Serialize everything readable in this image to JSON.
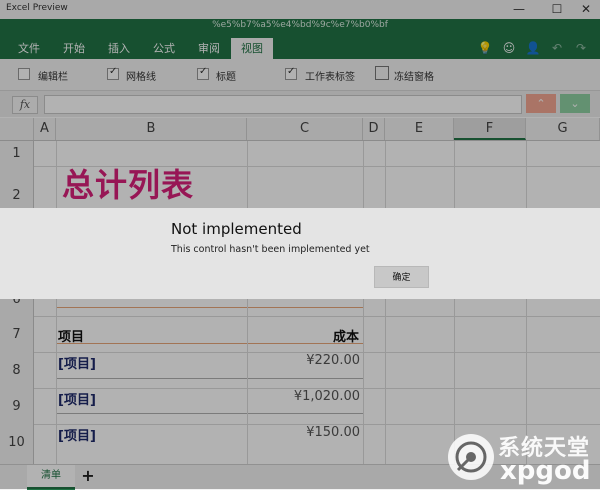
{
  "window": {
    "app_title": "Excel Preview",
    "doc_title": "%e5%b7%a5%e4%bd%9c%e7%b0%bf",
    "minimize": "—",
    "maximize": "☐",
    "close": "✕"
  },
  "tabs": [
    "文件",
    "开始",
    "插入",
    "公式",
    "审阅",
    "视图"
  ],
  "ribbon": {
    "options": [
      {
        "label": "编辑栏",
        "checked": false
      },
      {
        "label": "网格线",
        "checked": true
      },
      {
        "label": "标题",
        "checked": true
      },
      {
        "label": "工作表标签",
        "checked": true
      }
    ],
    "freeze_label": "冻结窗格"
  },
  "formula_bar": {
    "fx": "fx",
    "value": ""
  },
  "columns": [
    "A",
    "B",
    "C",
    "D",
    "E",
    "F",
    "G"
  ],
  "rows": [
    "1",
    "2",
    "6",
    "7",
    "8",
    "9",
    "10"
  ],
  "sheet": {
    "title": "总计列表",
    "header_item": "项目",
    "header_cost": "成本",
    "items": [
      {
        "name": "[项目]",
        "cost": "¥220.00"
      },
      {
        "name": "[项目]",
        "cost": "¥1,020.00"
      },
      {
        "name": "[项目]",
        "cost": "¥150.00"
      }
    ]
  },
  "sheet_tabs": {
    "active": "清单",
    "add": "+"
  },
  "dialog": {
    "title": "Not implemented",
    "message": "This control hasn't been implemented yet",
    "ok": "确定"
  },
  "watermark": {
    "line1": "系统天堂",
    "line2": "xpgod"
  },
  "colors": {
    "excel_green": "#217346",
    "title_pink": "#d9207a",
    "item_navy": "#1f2a6b"
  }
}
